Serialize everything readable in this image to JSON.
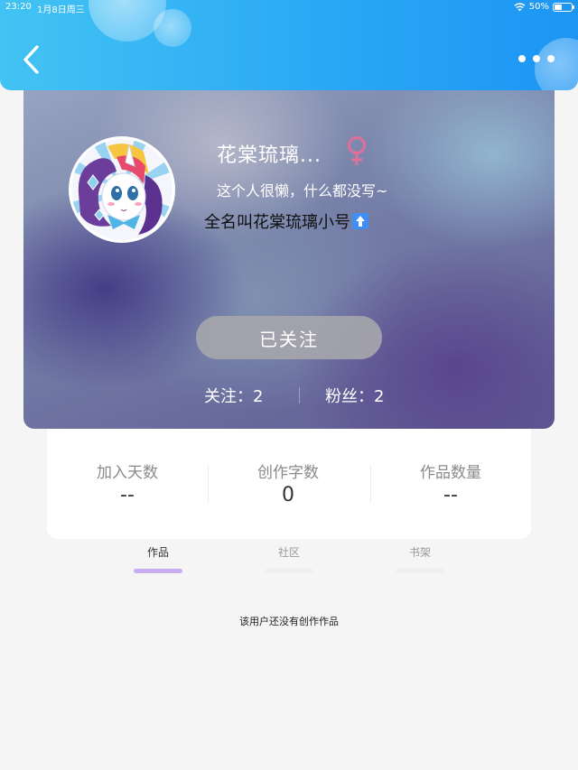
{
  "status_bar": {
    "time": "23:20",
    "date": "1月8日周三",
    "battery": "50%",
    "battery_level": 0.5
  },
  "profile": {
    "nickname": "花棠琉璃...",
    "gender_symbol": "♀",
    "bio": "这个人很懒，什么都没写~",
    "signature": "全名叫花棠琉璃小号",
    "follow_button_label": "已关注",
    "following_text": "关注：2",
    "fans_text": "粉丝：2"
  },
  "stats": [
    {
      "label": "加入天数",
      "value": "--"
    },
    {
      "label": "创作字数",
      "value": "0"
    },
    {
      "label": "作品数量",
      "value": "--"
    }
  ],
  "tabs": [
    {
      "label": "作品",
      "active": true
    },
    {
      "label": "社区",
      "active": false
    },
    {
      "label": "书架",
      "active": false
    }
  ],
  "empty_message": "该用户还没有创作作品",
  "colors": {
    "header_start": "#43c3f3",
    "header_end": "#1c95f3",
    "female_symbol": "#e0709a",
    "active_tab_underline": "#c8aef0",
    "follow_button": "#a5a5ac"
  },
  "icons": {
    "back": "chevron-left-icon",
    "more": "more-dots-icon",
    "gender": "female-icon",
    "signature_emoji": "up-arrow-icon"
  }
}
